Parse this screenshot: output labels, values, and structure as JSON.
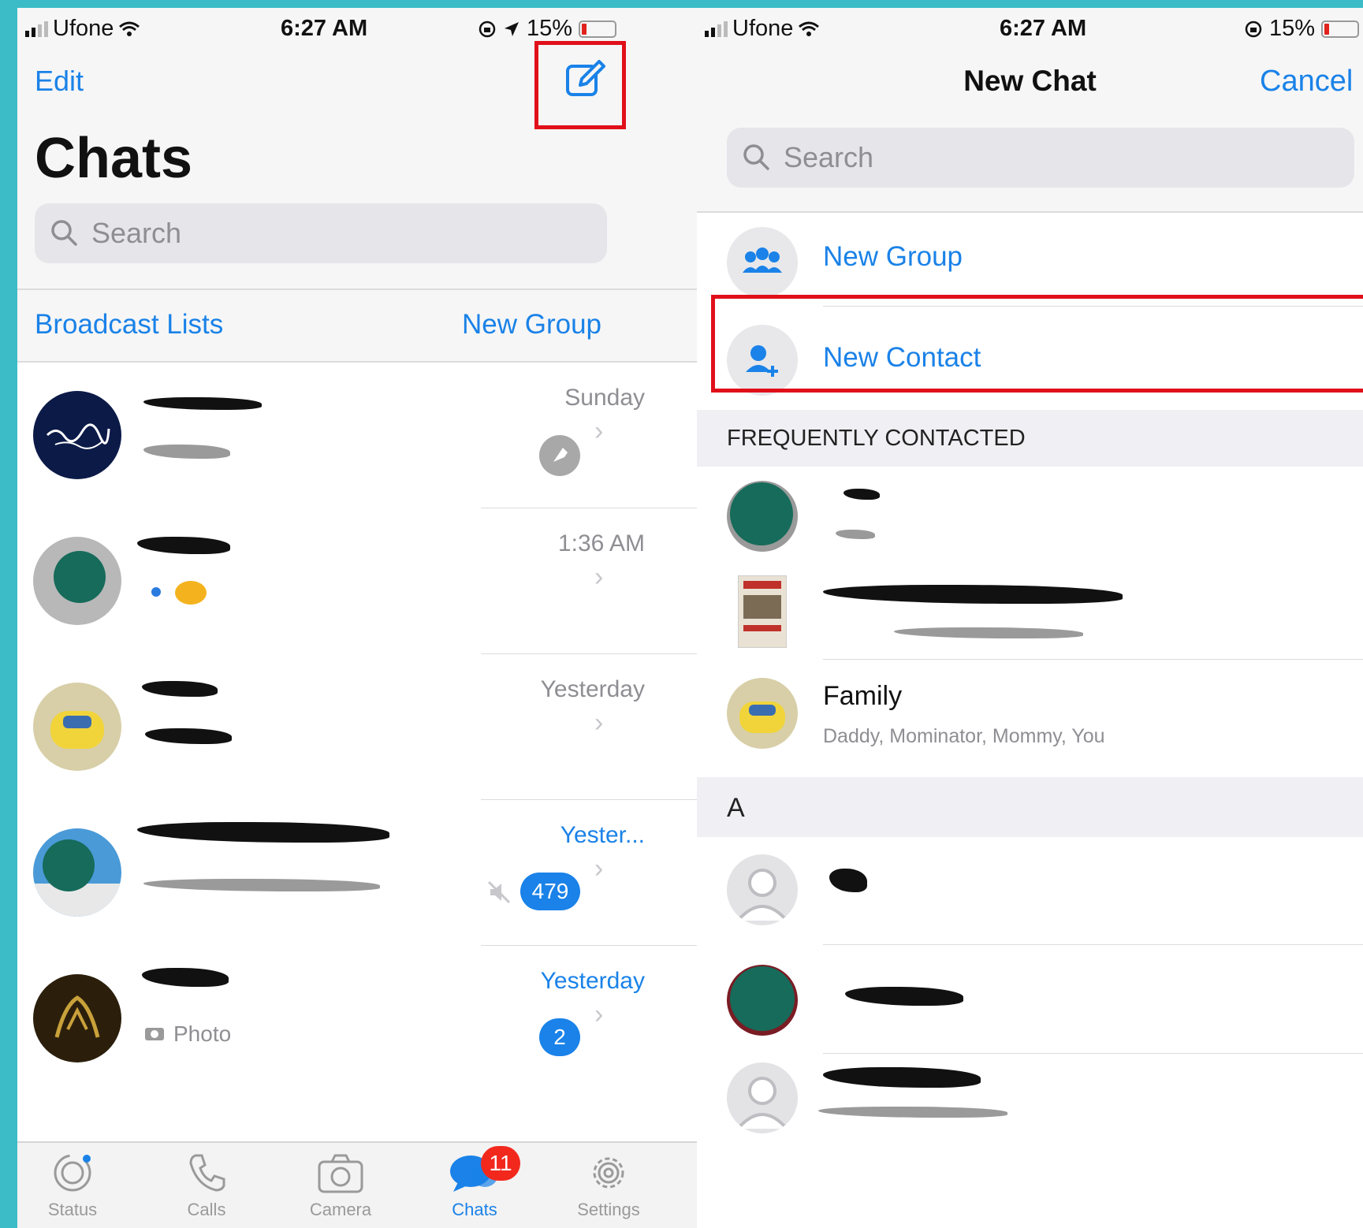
{
  "left": {
    "status": {
      "carrier": "Ufone",
      "time": "6:27 AM",
      "battery": "15%"
    },
    "nav": {
      "edit": "Edit"
    },
    "title": "Chats",
    "search_placeholder": "Search",
    "links": {
      "broadcast": "Broadcast Lists",
      "new_group": "New Group"
    },
    "chats": [
      {
        "time": "Sunday"
      },
      {
        "time": "1:36 AM"
      },
      {
        "time": "Yesterday"
      },
      {
        "time": "Yester...",
        "unread": "479"
      },
      {
        "time": "Yesterday",
        "unread": "2",
        "preview": "Photo"
      }
    ],
    "tabs": [
      {
        "label": "Status"
      },
      {
        "label": "Calls"
      },
      {
        "label": "Camera"
      },
      {
        "label": "Chats",
        "badge": "11"
      },
      {
        "label": "Settings"
      }
    ]
  },
  "right": {
    "status": {
      "carrier": "Ufone",
      "time": "6:27 AM",
      "battery": "15%"
    },
    "nav": {
      "title": "New Chat",
      "cancel": "Cancel"
    },
    "search_placeholder": "Search",
    "actions": {
      "new_group": "New Group",
      "new_contact": "New Contact"
    },
    "section_frequent": "FREQUENTLY CONTACTED",
    "family": {
      "name": "Family",
      "members": "Daddy, Mominator, Mommy, You"
    },
    "section_a": "A"
  },
  "colors": {
    "accent": "#1a82e8",
    "badge": "#f2281d",
    "highlight": "#e0101a",
    "frame": "#3cbcc7"
  }
}
